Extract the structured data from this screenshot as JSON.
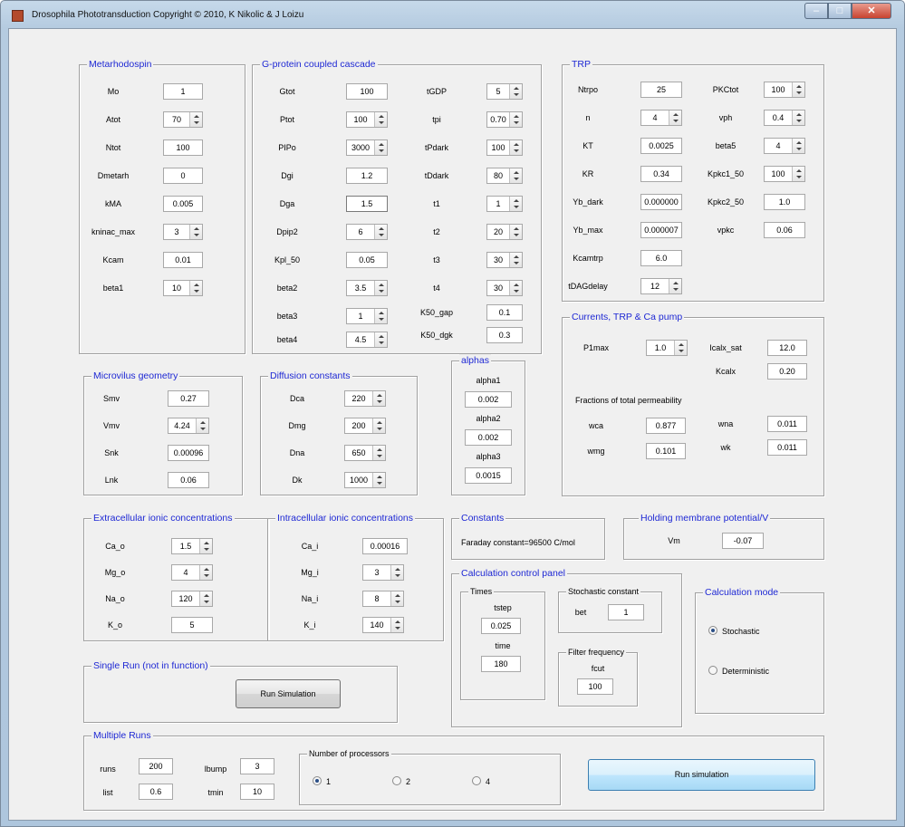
{
  "window": {
    "title": "Drosophila Phototransduction     Copyright © 2010,  K Nikolic & J Loizu",
    "min": "–",
    "max": "□",
    "close": "✕"
  },
  "metarhodopsin": {
    "title": "Metarhodospin",
    "mo": {
      "label": "Mo",
      "value": "1"
    },
    "atot": {
      "label": "Atot",
      "value": "70"
    },
    "ntot": {
      "label": "Ntot",
      "value": "100"
    },
    "dmetarh": {
      "label": "Dmetarh",
      "value": "0"
    },
    "kma": {
      "label": "kMA",
      "value": "0.005"
    },
    "kninac_max": {
      "label": "kninac_max",
      "value": "3"
    },
    "kcam": {
      "label": "Kcam",
      "value": "0.01"
    },
    "beta1": {
      "label": "beta1",
      "value": "10"
    }
  },
  "gprotein": {
    "title": "G-protein coupled cascade",
    "gtot": {
      "label": "Gtot",
      "value": "100"
    },
    "ptot": {
      "label": "Ptot",
      "value": "100"
    },
    "pip0": {
      "label": "PIPo",
      "value": "3000"
    },
    "dgi": {
      "label": "Dgi",
      "value": "1.2"
    },
    "dga": {
      "label": "Dga",
      "value": "1.5"
    },
    "dpip2": {
      "label": "Dpip2",
      "value": "6"
    },
    "kpi50": {
      "label": "Kpl_50",
      "value": "0.05"
    },
    "beta2": {
      "label": "beta2",
      "value": "3.5"
    },
    "beta3": {
      "label": "beta3",
      "value": "1"
    },
    "beta4": {
      "label": "beta4",
      "value": "4.5"
    },
    "tgdp": {
      "label": "tGDP",
      "value": "5"
    },
    "tpi": {
      "label": "tpi",
      "value": "0.70"
    },
    "tpdark": {
      "label": "tPdark",
      "value": "100"
    },
    "tddark": {
      "label": "tDdark",
      "value": "80"
    },
    "t1": {
      "label": "t1",
      "value": "1"
    },
    "t2": {
      "label": "t2",
      "value": "20"
    },
    "t3": {
      "label": "t3",
      "value": "30"
    },
    "t4": {
      "label": "t4",
      "value": "30"
    },
    "k50gap": {
      "label": "K50_gap",
      "value": "0.1"
    },
    "k50dgk": {
      "label": "K50_dgk",
      "value": "0.3"
    }
  },
  "trp": {
    "title": "TRP",
    "ntrpo": {
      "label": "Ntrpo",
      "value": "25"
    },
    "n": {
      "label": "n",
      "value": "4"
    },
    "kt": {
      "label": "KT",
      "value": "0.0025"
    },
    "kr": {
      "label": "KR",
      "value": "0.34"
    },
    "yb_dark": {
      "label": "Yb_dark",
      "value": "0.000000"
    },
    "yb_max": {
      "label": "Yb_max",
      "value": "0.000007"
    },
    "kcamtrp": {
      "label": "Kcamtrp",
      "value": "6.0"
    },
    "tdagdelay": {
      "label": "tDAGdelay",
      "value": "12"
    },
    "pkctot": {
      "label": "PKCtot",
      "value": "100"
    },
    "vph": {
      "label": "vph",
      "value": "0.4"
    },
    "beta5": {
      "label": "beta5",
      "value": "4"
    },
    "kpkc1": {
      "label": "Kpkc1_50",
      "value": "100"
    },
    "kpkc2": {
      "label": "Kpkc2_50",
      "value": "1.0"
    },
    "vpkc": {
      "label": "vpkc",
      "value": "0.06"
    }
  },
  "currents": {
    "title": "Currents, TRP & Ca pump",
    "p1max": {
      "label": "P1max",
      "value": "1.0"
    },
    "kcalx_sat": {
      "label": "Icalx_sat",
      "value": "12.0"
    },
    "kcalx": {
      "label": "Kcalx",
      "value": "0.20"
    },
    "fractions_label": "Fractions of total permeability",
    "wca": {
      "label": "wca",
      "value": "0.877"
    },
    "wmg": {
      "label": "wmg",
      "value": "0.101"
    },
    "wna": {
      "label": "wna",
      "value": "0.011"
    },
    "wk": {
      "label": "wk",
      "value": "0.011"
    }
  },
  "microvilus": {
    "title": "Microvilus geometry",
    "smv": {
      "label": "Smv",
      "value": "0.27"
    },
    "vmv": {
      "label": "Vmv",
      "value": "4.24"
    },
    "snk": {
      "label": "Snk",
      "value": "0.00096"
    },
    "lnk": {
      "label": "Lnk",
      "value": "0.06"
    }
  },
  "diffusion": {
    "title": "Diffusion constants",
    "dca": {
      "label": "Dca",
      "value": "220"
    },
    "dmg": {
      "label": "Dmg",
      "value": "200"
    },
    "dna": {
      "label": "Dna",
      "value": "650"
    },
    "dk": {
      "label": "Dk",
      "value": "1000"
    }
  },
  "alphas": {
    "title": "alphas",
    "alpha1": {
      "label": "alpha1",
      "value": "0.002"
    },
    "alpha2": {
      "label": "alpha2",
      "value": "0.002"
    },
    "alpha3": {
      "label": "alpha3",
      "value": "0.0015"
    }
  },
  "extracellular": {
    "title": "Extracellular ionic concentrations",
    "ca_o": {
      "label": "Ca_o",
      "value": "1.5"
    },
    "mg_o": {
      "label": "Mg_o",
      "value": "4"
    },
    "na_o": {
      "label": "Na_o",
      "value": "120"
    },
    "k_o": {
      "label": "K_o",
      "value": "5"
    }
  },
  "intracellular": {
    "title": "Intracellular ionic concentrations",
    "ca_i": {
      "label": "Ca_i",
      "value": "0.00016"
    },
    "mg_i": {
      "label": "Mg_i",
      "value": "3"
    },
    "na_i": {
      "label": "Na_i",
      "value": "8"
    },
    "k_i": {
      "label": "K_i",
      "value": "140"
    }
  },
  "constants": {
    "title": "Constants",
    "faraday": "Faraday constant=96500 C/mol"
  },
  "holding": {
    "title": "Holding membrane potential/V",
    "vm": {
      "label": "Vm",
      "value": "-0.07"
    }
  },
  "calc_control": {
    "title": "Calculation control panel",
    "times_title": "Times",
    "tstep": {
      "label": "tstep",
      "value": "0.025"
    },
    "time": {
      "label": "time",
      "value": "180"
    },
    "stochastic_title": "Stochastic constant",
    "bet": {
      "label": "bet",
      "value": "1"
    },
    "filter_title": "Filter frequency",
    "fcut": {
      "label": "fcut",
      "value": "100"
    }
  },
  "calc_mode": {
    "title": "Calculation mode",
    "stochastic": "Stochastic",
    "deterministic": "Deterministic",
    "selected": "Stochastic"
  },
  "single_run": {
    "title": "Single Run (not in function)",
    "button": "Run Simulation"
  },
  "multiple_runs": {
    "title": "Multiple Runs",
    "runs": {
      "label": "runs",
      "value": "200"
    },
    "lbump": {
      "label": "lbump",
      "value": "3"
    },
    "list": {
      "label": "list",
      "value": "0.6"
    },
    "tmin": {
      "label": "tmin",
      "value": "10"
    },
    "processors_title": "Number of processors",
    "proc1": "1",
    "proc2": "2",
    "proc4": "4",
    "selected": "1",
    "button": "Run simulation"
  }
}
